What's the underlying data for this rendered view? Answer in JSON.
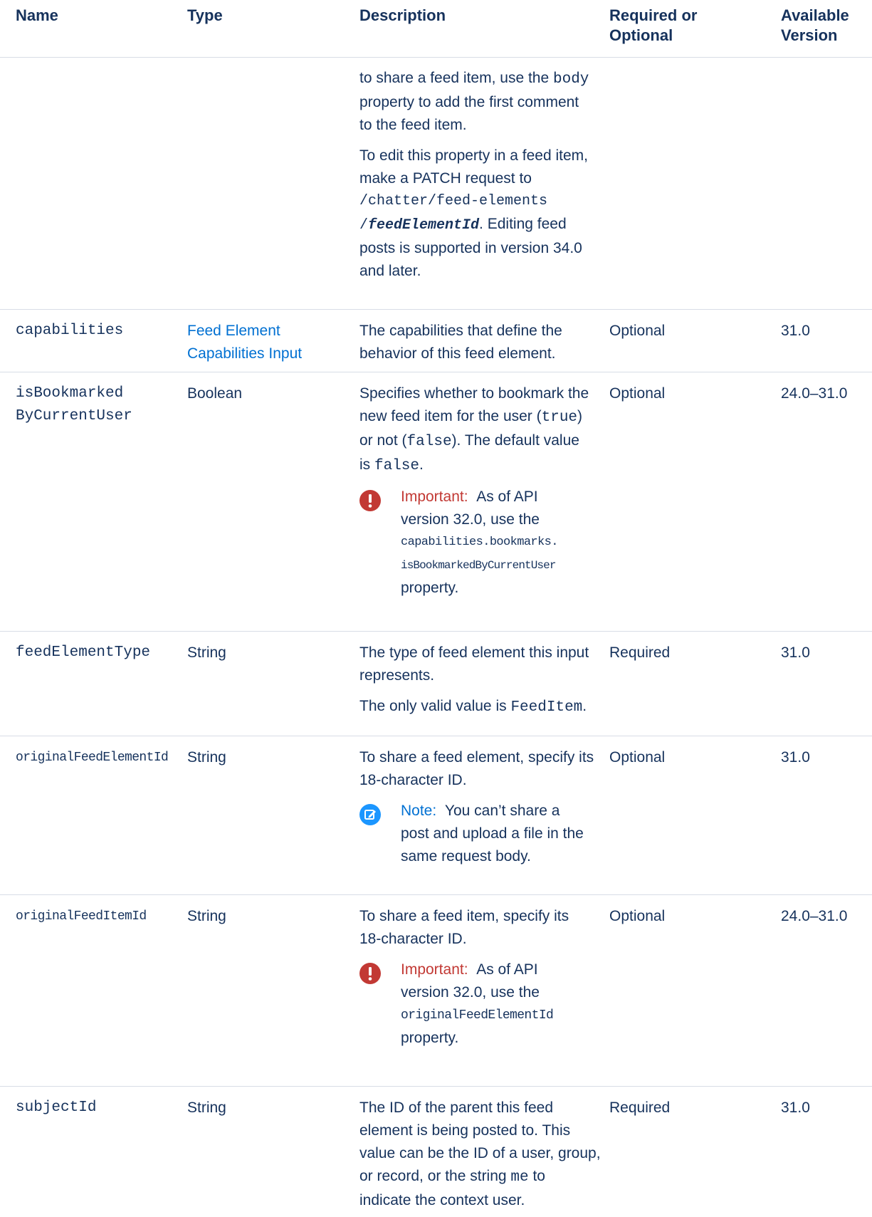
{
  "header": {
    "name": "Name",
    "type": "Type",
    "description": "Description",
    "required_or_optional_line1": "Required or",
    "required_or_optional_line2": "Optional",
    "available_version_line1": "Available",
    "available_version_line2": "Version"
  },
  "row0": {
    "desc_line1_pre": "to share a feed item, use the ",
    "desc_line1_code": "body",
    "desc_line2": "property to add the first comment",
    "desc_line3": "to the feed item.",
    "para2_line1": "To edit this property in a feed item,",
    "para2_line2": "make a PATCH request to",
    "para2_code1": "/chatter/feed-elements",
    "para2_code2_slash": "/",
    "para2_code2_var": "feedElementId",
    "para2_line4_post": ". Editing feed",
    "para2_line5": "posts is supported in version 34.0",
    "para2_line6": "and later."
  },
  "row1": {
    "name": "capabilities",
    "type_line1": "Feed Element",
    "type_line2": "Capabilities Input",
    "desc_line1": "The capabilities that define the",
    "desc_line2": "behavior of this feed element.",
    "required": "Optional",
    "version": "31.0"
  },
  "row2": {
    "name_line1": "isBookmarked",
    "name_line2": "ByCurrentUser",
    "type": "Boolean",
    "desc_line1": "Specifies whether to bookmark the",
    "desc_line2_pre": "new feed item for the user (",
    "desc_line2_code": "true",
    "desc_line2_post": ")",
    "desc_line3_pre": "or not (",
    "desc_line3_code": "false",
    "desc_line3_post": "). The default value",
    "desc_line4_pre": "is ",
    "desc_line4_code": "false",
    "desc_line4_post": ".",
    "callout_label": "Important:",
    "callout_line1": "As of API",
    "callout_line2": "version 32.0, use the",
    "callout_code1": "capabilities.bookmarks.",
    "callout_code2": "isBookmarkedByCurrentUser",
    "callout_line5": "property.",
    "required": "Optional",
    "version": "24.0–31.0"
  },
  "row3": {
    "name": "feedElementType",
    "type": "String",
    "desc_line1": "The type of feed element this input",
    "desc_line2": "represents.",
    "desc_line3_pre": "The only valid value is ",
    "desc_line3_code": "FeedItem",
    "desc_line3_post": ".",
    "required": "Required",
    "version": "31.0"
  },
  "row4": {
    "name": "originalFeedElementId",
    "type": "String",
    "desc_line1": "To share a feed element, specify its",
    "desc_line2": "18-character ID.",
    "callout_label": "Note:",
    "callout_line1": "You can’t share a",
    "callout_line2": "post and upload a file in the",
    "callout_line3": "same request body.",
    "required": "Optional",
    "version": "31.0"
  },
  "row5": {
    "name": "originalFeedItemId",
    "type": "String",
    "desc_line1": "To share a feed item, specify its",
    "desc_line2": "18-character ID.",
    "callout_label": "Important:",
    "callout_line1": "As of API",
    "callout_line2": "version 32.0, use the",
    "callout_code1": "originalFeedElementId",
    "callout_line4": "property.",
    "required": "Optional",
    "version": "24.0–31.0"
  },
  "row6": {
    "name": "subjectId",
    "type": "String",
    "desc_line1": "The ID of the parent this feed",
    "desc_line2": "element is being posted to. This",
    "desc_line3": "value can be the ID of a user, group,",
    "desc_line4_pre": "or record, or the string ",
    "desc_line4_code": "me",
    "desc_line4_post": " to",
    "desc_line5": "indicate the context user.",
    "required": "Required",
    "version": "31.0"
  }
}
